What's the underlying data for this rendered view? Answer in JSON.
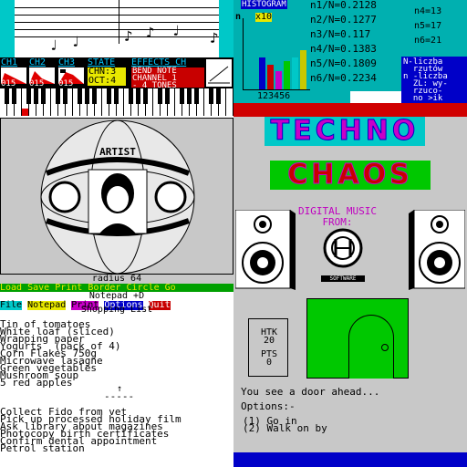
{
  "music": {
    "channels": [
      {
        "label": "CH1",
        "value": "015"
      },
      {
        "label": "CH2",
        "value": "015"
      },
      {
        "label": "CH3",
        "value": "015"
      }
    ],
    "state_label": "STATE",
    "state_lines": [
      "CHN:3",
      "OCT:4"
    ],
    "effects_label": "EFFECTS CH",
    "effects_lines": [
      "BEND NOTE",
      "CHANNEL 1",
      "- 4 TONES"
    ]
  },
  "histogram": {
    "title": "HISTOGRAM",
    "n_label": "n",
    "multiplier": "x10",
    "axis": "123456",
    "bar_values": [
      0.45,
      0.35,
      0.25,
      0.4,
      0.45,
      0.55
    ],
    "bar_colors": [
      "#0000c8",
      "#c80000",
      "#c800c8",
      "#00c800",
      "#00c8c8",
      "#c8c800"
    ]
  },
  "stats": [
    "n1/N=0.2128",
    "n2/N=0.1277",
    "n3/N=0.117",
    "n4/N=0.1383",
    "n5/N=0.1809",
    "n6/N=0.2234"
  ],
  "counts": [
    "n4=13",
    "n5=17",
    "n6=21"
  ],
  "info": [
    "N-liczba",
    "  rzutów",
    "n -liczba",
    "  ZL: wy-",
    "  rzuco-",
    "  no >ik"
  ],
  "picture": {
    "radius_label": "radius  64",
    "menu": "Load Save Print Border Circle Go"
  },
  "notepad": {
    "title": "Notepad +D",
    "menu": [
      {
        "label": "File",
        "bg": "#00c8c8",
        "fg": "#000"
      },
      {
        "label": "Notepad",
        "bg": "#e8e800",
        "fg": "#000"
      },
      {
        "label": "Print",
        "bg": "#c800c8",
        "fg": "#000"
      },
      {
        "label": "Options",
        "bg": "#0000c8",
        "fg": "#fff"
      },
      {
        "label": "Quit",
        "bg": "#c80000",
        "fg": "#fff"
      }
    ],
    "list_title": "Shopping List",
    "shopping": [
      "Tin of tomatoes",
      "White loaf (sliced)",
      "Wrapping paper",
      "Yogurts  (pack of 4)",
      "Corn Flakes 750g",
      "Microwave lasagne",
      "Green vegetables",
      "Mushroom soup",
      "5 red apples"
    ],
    "arrow": "↑",
    "divider": "-----",
    "todo": [
      "Collect Fido from vet",
      "Pick up processed holiday film",
      "Ask library about magazines",
      "Photocopy birth certificates",
      "Confirm dental appointment",
      "Petrol station"
    ]
  },
  "brand": {
    "word1": "TECHNO",
    "word2": "CHAOS",
    "digital": "DIGITAL MUSIC",
    "from": "FROM:",
    "software": "SOFTWARE"
  },
  "adventure": {
    "htk_label": "HTK",
    "htk_value": "20",
    "pts_label": "PTS",
    "pts_value": "0",
    "message": "You see a door ahead...",
    "options_label": "Options:-",
    "option1": "(1) Go in",
    "option2": "(2) Walk on by"
  }
}
